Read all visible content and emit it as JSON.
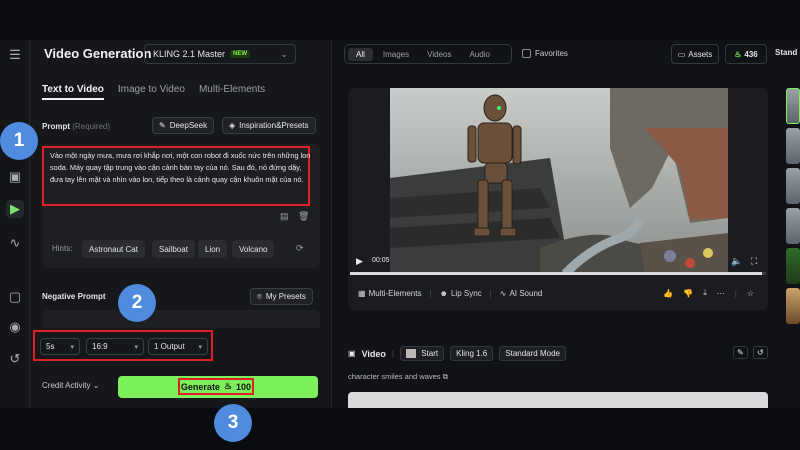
{
  "panel": {
    "title": "Video Generation",
    "model": "KLING 2.1 Master",
    "model_badge": "NEW",
    "tabs": [
      "Text to Video",
      "Image to Video",
      "Multi-Elements"
    ],
    "prompt_label": "Prompt",
    "prompt_required": "(Required)",
    "deepseek": "DeepSeek",
    "inspiration": "Inspiration&Presets",
    "prompt_text": "Vào một ngày mưa, mưa rơi khắp nơi, một con robot đi xuốc nức trên những lon soda. Máy quay tập trung vào cận cảnh bàn tay của nó. Sau đó, nó đứng dậy, đưa tay lên mặt và nhìn vào lon, tiếp theo là cảnh quay cận khuôn mặt của nó.",
    "hints_label": "Hints:",
    "hints": [
      "Astronaut Cat",
      "Sailboat",
      "Lion",
      "Volcano"
    ],
    "negative_label": "Negative Prompt",
    "my_presets": "My Presets",
    "duration": "5s",
    "ratio": "16:9",
    "outputs": "1 Output",
    "credit_activity": "Credit Activity",
    "generate": "Generate",
    "generate_cost": "100"
  },
  "topbar": {
    "filters": [
      "All",
      "Images",
      "Videos",
      "Audio"
    ],
    "favorites": "Favorites",
    "assets": "Assets",
    "credits": "436",
    "plan": "Stand"
  },
  "video": {
    "time": "00:05",
    "progress": 0.99,
    "actions": [
      "Multi-Elements",
      "Lip Sync",
      "AI Sound"
    ]
  },
  "result": {
    "heading": "Video",
    "tags": [
      "Start",
      "Kling 1.6",
      "Standard Mode"
    ],
    "caption": "character smiles and waves"
  },
  "badges": [
    "1",
    "2",
    "3"
  ],
  "colors": {
    "accent": "#7bf05a",
    "annotation": "#e01e26",
    "badge": "#4f8ce0"
  }
}
